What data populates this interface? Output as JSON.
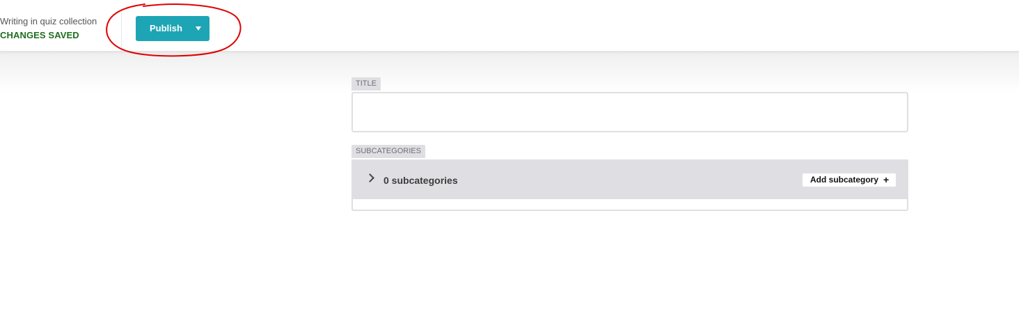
{
  "header": {
    "context_label": "Writing in quiz collection",
    "status": "CHANGES SAVED",
    "publish_label": "Publish"
  },
  "fields": {
    "title": {
      "label": "TITLE",
      "value": "",
      "placeholder": ""
    },
    "subcategories": {
      "label": "SUBCATEGORIES",
      "count_text": "0 subcategories",
      "add_label": "Add subcategory"
    }
  },
  "icons": {
    "publish_dropdown": "caret-down-icon",
    "expand": "chevron-right-icon",
    "add": "plus-icon"
  },
  "colors": {
    "accent": "#1ea5b5",
    "status_saved": "#1e6e1e",
    "annotation": "#e00000",
    "panel": "#dfdfe3"
  }
}
